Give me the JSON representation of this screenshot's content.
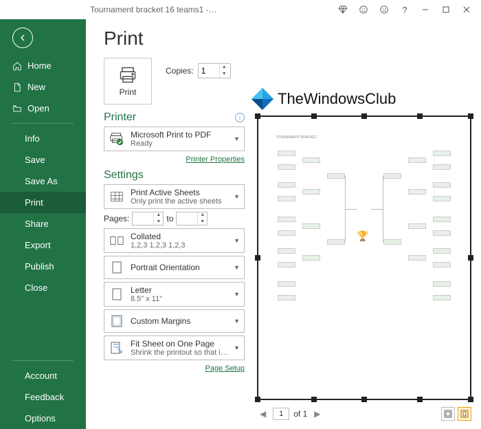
{
  "window": {
    "title": "Tournament bracket 16 teams1  -…"
  },
  "sidebar": {
    "items": [
      {
        "label": "Home",
        "icon": "home"
      },
      {
        "label": "New",
        "icon": "new"
      },
      {
        "label": "Open",
        "icon": "open"
      }
    ],
    "sub_items": [
      {
        "label": "Info"
      },
      {
        "label": "Save"
      },
      {
        "label": "Save As"
      },
      {
        "label": "Print",
        "active": true
      },
      {
        "label": "Share"
      },
      {
        "label": "Export"
      },
      {
        "label": "Publish"
      },
      {
        "label": "Close"
      }
    ],
    "bottom_items": [
      {
        "label": "Account"
      },
      {
        "label": "Feedback"
      },
      {
        "label": "Options"
      }
    ]
  },
  "print": {
    "title": "Print",
    "button_label": "Print",
    "copies_label": "Copies:",
    "copies_value": "1",
    "printer_heading": "Printer",
    "printer": {
      "name": "Microsoft Print to PDF",
      "status": "Ready"
    },
    "printer_props_link": "Printer Properties",
    "settings_heading": "Settings",
    "print_active": {
      "line1": "Print Active Sheets",
      "line2": "Only print the active sheets"
    },
    "pages_label": "Pages:",
    "pages_to": "to",
    "collated": {
      "line1": "Collated",
      "line2": "1,2,3     1,2,3     1,2,3"
    },
    "orientation": "Portrait Orientation",
    "paper": {
      "line1": "Letter",
      "line2": "8.5\" x 11\""
    },
    "margins": "Custom Margins",
    "scaling": {
      "line1": "Fit Sheet on One Page",
      "line2": "Shrink the printout so that it…"
    },
    "page_setup_link": "Page Setup"
  },
  "preview": {
    "watermark_text": "TheWindowsClub",
    "page_current": "1",
    "page_of": "of 1"
  }
}
